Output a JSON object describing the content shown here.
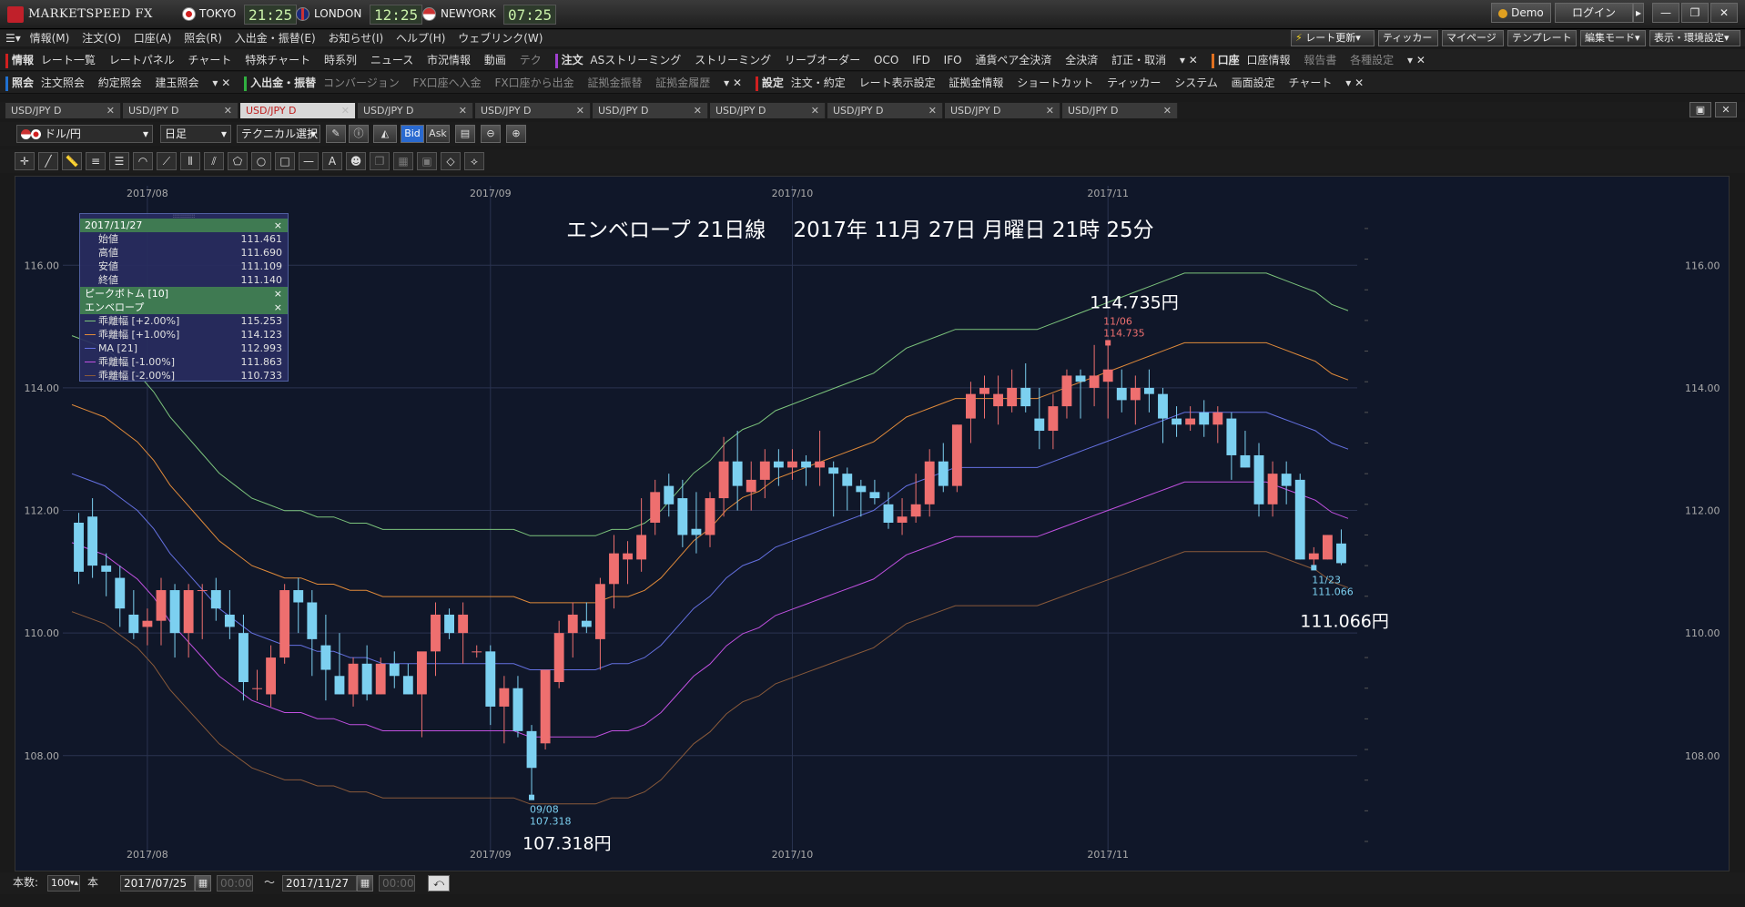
{
  "app": {
    "name": "MARKETSPEED FX"
  },
  "clocks": [
    {
      "city": "TOKYO",
      "time": "21:25"
    },
    {
      "city": "LONDON",
      "time": "12:25"
    },
    {
      "city": "NEWYORK",
      "time": "07:25"
    }
  ],
  "title_buttons": {
    "demo": "Demo",
    "login": "ログイン"
  },
  "menu": [
    "情報(M)",
    "注文(O)",
    "口座(A)",
    "照会(R)",
    "入出金・振替(E)",
    "お知らせ(I)",
    "ヘルプ(H)",
    "ウェブリンク(W)"
  ],
  "menu_right": [
    "レート更新",
    "ティッカー",
    "マイページ",
    "テンプレート",
    "編集モード",
    "表示・環境設定"
  ],
  "toolbar1": {
    "group1_head": "情報",
    "group1": [
      "レート一覧",
      "レートパネル",
      "チャート",
      "特殊チャート",
      "時系列",
      "ニュース",
      "市況情報",
      "動画",
      "テク"
    ],
    "group2_head": "注文",
    "group2": [
      "ASストリーミング",
      "ストリーミング",
      "リーブオーダー",
      "OCO",
      "IFD",
      "IFO",
      "通貨ペア全決済",
      "全決済",
      "訂正・取消"
    ],
    "group3_head": "口座",
    "group3": [
      "口座情報"
    ],
    "group3_dim": [
      "報告書",
      "各種設定"
    ]
  },
  "toolbar2": {
    "group1_head": "照会",
    "group1": [
      "注文照会",
      "約定照会",
      "建玉照会"
    ],
    "group2_head": "入出金・振替",
    "group2_dim": [
      "コンバージョン",
      "FX口座へ入金",
      "FX口座から出金",
      "証拠金振替",
      "証拠金履歴"
    ],
    "group3_head": "設定",
    "group3": [
      "注文・約定",
      "レート表示設定",
      "証拠金情報",
      "ショートカット",
      "ティッカー",
      "システム",
      "画面設定",
      "チャート"
    ]
  },
  "tabs": [
    "USD/JPY D",
    "USD/JPY D",
    "USD/JPY D",
    "USD/JPY D",
    "USD/JPY D",
    "USD/JPY D",
    "USD/JPY D",
    "USD/JPY D",
    "USD/JPY D",
    "USD/JPY D"
  ],
  "active_tab": 2,
  "controls": {
    "pair": "ドル/円",
    "period": "日足",
    "technical": "テクニカル選択",
    "bid": "Bid",
    "ask": "Ask"
  },
  "legend": {
    "date": "2017/11/27",
    "ohlc": [
      {
        "label": "始値",
        "value": "111.461"
      },
      {
        "label": "高値",
        "value": "111.690"
      },
      {
        "label": "安値",
        "value": "111.109"
      },
      {
        "label": "終値",
        "value": "111.140"
      }
    ],
    "indicator1": "ピークボトム [10]",
    "indicator2": "エンベロープ",
    "lines": [
      {
        "label": "乖離幅 [+2.00%]",
        "value": "115.253",
        "color": "#7cc47c"
      },
      {
        "label": "乖離幅 [+1.00%]",
        "value": "114.123",
        "color": "#e08a3a"
      },
      {
        "label": "MA [21]",
        "value": "112.993",
        "color": "#6470e0"
      },
      {
        "label": "乖離幅 [-1.00%]",
        "value": "111.863",
        "color": "#c050e0"
      },
      {
        "label": "乖離幅 [-2.00%]",
        "value": "110.733",
        "color": "#8a5a3a"
      }
    ]
  },
  "bottom": {
    "count_label": "本数:",
    "count_value": "100",
    "count_unit": "本",
    "from": "2017/07/25",
    "from_time": "00:00",
    "tilde": "〜",
    "to": "2017/11/27",
    "to_time": "00:00"
  },
  "chart_data": {
    "type": "candlestick",
    "title": "エンベロープ 21日線　 2017年 11月 27日 月曜日 21時 25分",
    "x_ticks": [
      "2017/08",
      "2017/09",
      "2017/10",
      "2017/11"
    ],
    "x_tick_index": [
      5,
      30,
      52,
      75
    ],
    "y_ticks": [
      "116.00",
      "114.00",
      "112.00",
      "110.00",
      "108.00"
    ],
    "ylim": [
      106.6,
      117.0
    ],
    "colors": {
      "up": "#ee6f6f",
      "down": "#7cd0f0"
    },
    "candles": [
      [
        111.8,
        111.96,
        110.8,
        111.0
      ],
      [
        111.9,
        112.2,
        110.9,
        111.1
      ],
      [
        111.1,
        111.3,
        110.6,
        111.0
      ],
      [
        110.9,
        111.1,
        110.1,
        110.4
      ],
      [
        110.3,
        110.7,
        109.9,
        110.0
      ],
      [
        110.1,
        110.4,
        109.8,
        110.2
      ],
      [
        110.2,
        110.9,
        109.8,
        110.7
      ],
      [
        110.7,
        110.8,
        109.6,
        110.0
      ],
      [
        110.0,
        110.8,
        109.6,
        110.7
      ],
      [
        110.7,
        110.8,
        109.9,
        110.7
      ],
      [
        110.7,
        110.9,
        110.2,
        110.4
      ],
      [
        110.3,
        110.7,
        109.9,
        110.1
      ],
      [
        110.0,
        110.3,
        108.9,
        109.2
      ],
      [
        109.1,
        109.4,
        108.9,
        109.1
      ],
      [
        109.0,
        109.8,
        108.8,
        109.6
      ],
      [
        109.6,
        110.8,
        109.5,
        110.7
      ],
      [
        110.7,
        110.9,
        110.0,
        110.5
      ],
      [
        110.5,
        110.7,
        109.3,
        109.9
      ],
      [
        109.8,
        110.3,
        108.9,
        109.4
      ],
      [
        109.3,
        110.0,
        109.0,
        109.0
      ],
      [
        109.0,
        109.6,
        108.8,
        109.5
      ],
      [
        109.5,
        109.8,
        108.9,
        109.0
      ],
      [
        109.0,
        109.6,
        109.0,
        109.5
      ],
      [
        109.5,
        109.7,
        109.1,
        109.3
      ],
      [
        109.3,
        109.5,
        109.0,
        109.0
      ],
      [
        109.0,
        109.4,
        108.3,
        109.7
      ],
      [
        109.7,
        110.5,
        109.3,
        110.3
      ],
      [
        110.3,
        110.4,
        109.9,
        110.0
      ],
      [
        110.0,
        110.5,
        109.5,
        110.3
      ],
      [
        109.7,
        109.8,
        109.6,
        109.7
      ],
      [
        109.7,
        109.8,
        108.5,
        108.8
      ],
      [
        108.8,
        109.3,
        108.2,
        109.1
      ],
      [
        109.1,
        109.3,
        108.3,
        108.4
      ],
      [
        108.4,
        108.5,
        107.32,
        107.8
      ],
      [
        108.2,
        109.4,
        108.1,
        109.4
      ],
      [
        109.2,
        110.2,
        109.1,
        110.0
      ],
      [
        110.0,
        110.5,
        109.6,
        110.3
      ],
      [
        110.2,
        110.5,
        110.0,
        110.1
      ],
      [
        109.9,
        110.9,
        109.4,
        110.8
      ],
      [
        110.8,
        111.6,
        110.4,
        111.3
      ],
      [
        111.2,
        111.5,
        110.8,
        111.3
      ],
      [
        111.2,
        112.2,
        111.0,
        111.6
      ],
      [
        111.8,
        112.5,
        111.6,
        112.3
      ],
      [
        112.4,
        112.6,
        111.9,
        112.1
      ],
      [
        112.2,
        112.5,
        111.4,
        111.6
      ],
      [
        111.7,
        112.3,
        111.3,
        111.6
      ],
      [
        111.6,
        112.3,
        111.4,
        112.2
      ],
      [
        112.2,
        113.2,
        111.9,
        112.8
      ],
      [
        112.8,
        113.3,
        112.0,
        112.4
      ],
      [
        112.3,
        112.8,
        112.0,
        112.5
      ],
      [
        112.5,
        113.0,
        112.2,
        112.8
      ],
      [
        112.8,
        113.0,
        112.4,
        112.7
      ],
      [
        112.7,
        113.0,
        112.5,
        112.8
      ],
      [
        112.8,
        112.9,
        112.4,
        112.7
      ],
      [
        112.7,
        113.3,
        112.4,
        112.8
      ],
      [
        112.7,
        112.8,
        111.9,
        112.6
      ],
      [
        112.6,
        112.7,
        112.0,
        112.4
      ],
      [
        112.4,
        112.5,
        111.9,
        112.3
      ],
      [
        112.3,
        112.5,
        112.1,
        112.2
      ],
      [
        112.1,
        112.3,
        111.7,
        111.8
      ],
      [
        111.8,
        112.2,
        111.6,
        111.9
      ],
      [
        111.9,
        112.6,
        111.8,
        112.1
      ],
      [
        112.1,
        113.0,
        111.9,
        112.8
      ],
      [
        112.8,
        113.1,
        112.3,
        112.4
      ],
      [
        112.4,
        113.4,
        112.3,
        113.4
      ],
      [
        113.5,
        114.1,
        113.1,
        113.9
      ],
      [
        113.9,
        114.2,
        113.5,
        114.0
      ],
      [
        113.7,
        114.2,
        113.4,
        113.9
      ],
      [
        113.7,
        114.3,
        113.6,
        114.0
      ],
      [
        114.0,
        114.4,
        113.6,
        113.7
      ],
      [
        113.5,
        114.0,
        113.0,
        113.3
      ],
      [
        113.3,
        113.9,
        113.0,
        113.7
      ],
      [
        113.7,
        114.3,
        113.5,
        114.2
      ],
      [
        114.2,
        114.3,
        113.5,
        114.1
      ],
      [
        114.0,
        114.7,
        113.7,
        114.2
      ],
      [
        114.1,
        114.735,
        113.5,
        114.3
      ],
      [
        114.0,
        114.3,
        113.6,
        113.8
      ],
      [
        113.8,
        114.2,
        113.4,
        114.0
      ],
      [
        114.0,
        114.3,
        113.6,
        113.9
      ],
      [
        113.9,
        114.0,
        113.1,
        113.5
      ],
      [
        113.5,
        113.7,
        113.2,
        113.4
      ],
      [
        113.4,
        113.7,
        113.3,
        113.5
      ],
      [
        113.6,
        113.8,
        113.2,
        113.4
      ],
      [
        113.4,
        113.7,
        113.1,
        113.6
      ],
      [
        113.5,
        113.6,
        112.5,
        112.9
      ],
      [
        112.9,
        113.3,
        112.7,
        112.7
      ],
      [
        112.9,
        113.1,
        111.9,
        112.1
      ],
      [
        112.1,
        112.8,
        111.9,
        112.6
      ],
      [
        112.6,
        112.8,
        112.1,
        112.4
      ],
      [
        112.5,
        112.6,
        111.2,
        111.2
      ],
      [
        111.2,
        111.4,
        111.066,
        111.3
      ],
      [
        111.2,
        111.6,
        111.2,
        111.6
      ],
      [
        111.461,
        111.69,
        111.109,
        111.14
      ]
    ],
    "envelope": {
      "ma": [
        112.6,
        112.5,
        112.4,
        112.2,
        112.0,
        111.7,
        111.3,
        111.0,
        110.7,
        110.4,
        110.2,
        110.0,
        109.9,
        109.8,
        109.8,
        109.7,
        109.7,
        109.6,
        109.6,
        109.5,
        109.5,
        109.5,
        109.5,
        109.5,
        109.5,
        109.5,
        109.5,
        109.5,
        109.4,
        109.4,
        109.4,
        109.4,
        109.4,
        109.5,
        109.5,
        109.6,
        109.8,
        110.1,
        110.4,
        110.6,
        110.9,
        111.1,
        111.2,
        111.4,
        111.5,
        111.6,
        111.7,
        111.8,
        111.9,
        112.0,
        112.2,
        112.4,
        112.5,
        112.6,
        112.7,
        112.7,
        112.7,
        112.7,
        112.7,
        112.7,
        112.8,
        112.9,
        113.0,
        113.1,
        113.2,
        113.3,
        113.4,
        113.5,
        113.6,
        113.6,
        113.6,
        113.6,
        113.6,
        113.6,
        113.5,
        113.4,
        113.3,
        113.1,
        113.0
      ],
      "ma_index": [
        0,
        1,
        2,
        3,
        4,
        5,
        6,
        7,
        8,
        9,
        10,
        11,
        12,
        13,
        14,
        15,
        16,
        17,
        18,
        19,
        20,
        21,
        22,
        23,
        24,
        25,
        26,
        27,
        28,
        29,
        30,
        31,
        32,
        33,
        34,
        35,
        36,
        37,
        38,
        39,
        40,
        41,
        42,
        43,
        44,
        45,
        46,
        47,
        48,
        49,
        50,
        51,
        52,
        53,
        54,
        55,
        56,
        57,
        58,
        59,
        60,
        61,
        62,
        63,
        64,
        65,
        66,
        67,
        68,
        69,
        70,
        71,
        72,
        73,
        74,
        75,
        76,
        77,
        78
      ],
      "ma_start": 14
    },
    "annotations": [
      {
        "label": "114.735円",
        "sub_date": "11/06",
        "sub_value": "114.735",
        "index": 75,
        "price": 114.735,
        "pos": "above"
      },
      {
        "label": "107.318円",
        "sub_date": "09/08",
        "sub_value": "107.318",
        "index": 33,
        "price": 107.318,
        "pos": "below"
      },
      {
        "label": "111.066円",
        "sub_date": "11/23",
        "sub_value": "111.066",
        "index": 90,
        "price": 111.066,
        "pos": "below"
      }
    ]
  }
}
